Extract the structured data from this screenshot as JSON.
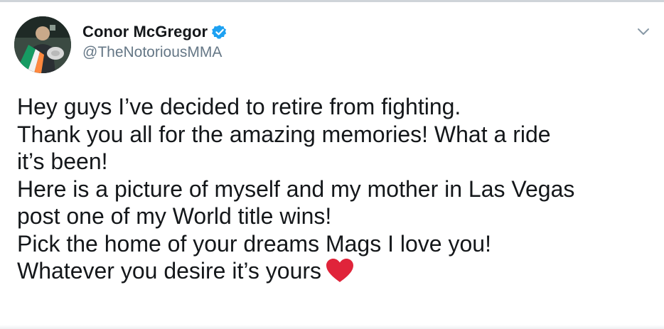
{
  "tweet": {
    "author": {
      "display_name": "Conor McGregor",
      "handle": "@TheNotoriousMMA",
      "verified": true,
      "avatar_icon": "avatar-photo"
    },
    "menu_icon": "chevron-down-icon",
    "lines": [
      "Hey guys I’ve decided to retire from fighting.",
      "Thank you all for the amazing memories! What a ride",
      "it’s been!",
      "Here is a picture of myself and my mother in Las Vegas",
      "post one of my World title wins!",
      "Pick the home of your dreams Mags I love you!",
      "Whatever you desire it’s yours"
    ],
    "trailing_emoji": "red-heart-icon"
  },
  "colors": {
    "text": "#14171a",
    "secondary_text": "#657786",
    "verified_blue": "#1da1f2",
    "heart_red": "#e0243a"
  }
}
